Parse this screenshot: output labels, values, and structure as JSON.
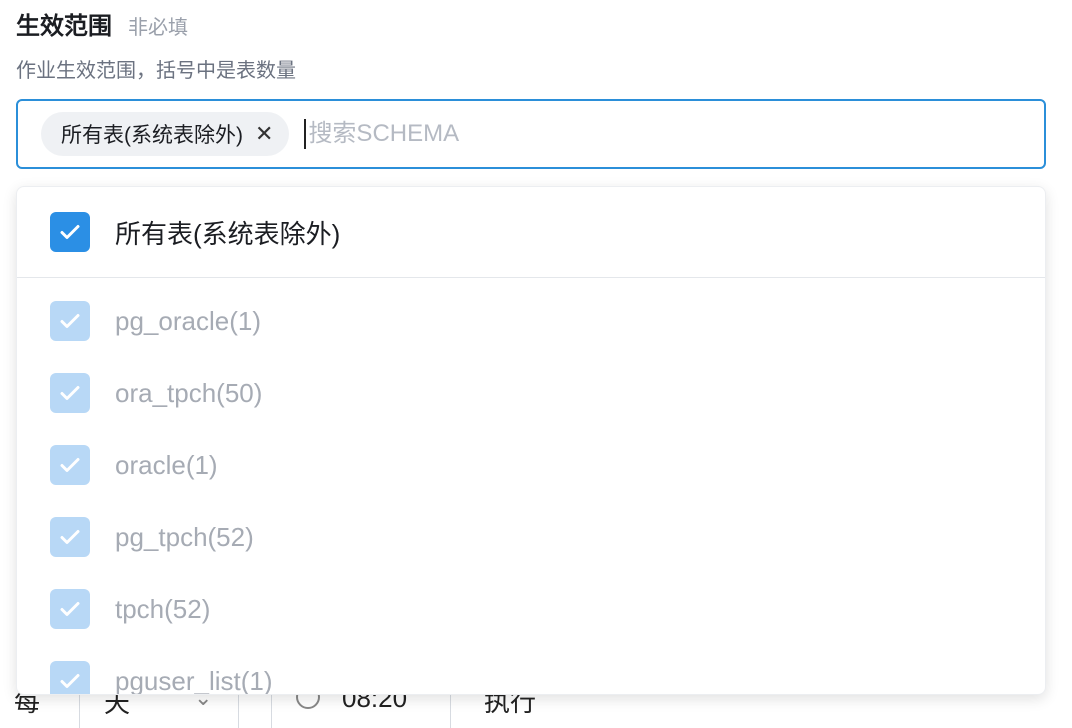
{
  "field": {
    "label": "生效范围",
    "optional": "非必填",
    "description": "作业生效范围，括号中是表数量"
  },
  "select": {
    "selected_tags": [
      {
        "label": "所有表(系统表除外)",
        "close_glyph": "✕"
      }
    ],
    "search_placeholder": "搜索SCHEMA",
    "search_value": ""
  },
  "dropdown": {
    "all_option": {
      "label": "所有表(系统表除外)",
      "checked": true
    },
    "options": [
      {
        "label": "pg_oracle(1)",
        "checked": true,
        "disabled": true
      },
      {
        "label": "ora_tpch(50)",
        "checked": true,
        "disabled": true
      },
      {
        "label": "oracle(1)",
        "checked": true,
        "disabled": true
      },
      {
        "label": "pg_tpch(52)",
        "checked": true,
        "disabled": true
      },
      {
        "label": "tpch(52)",
        "checked": true,
        "disabled": true
      },
      {
        "label": "pguser_list(1)",
        "checked": true,
        "disabled": true
      }
    ]
  },
  "schedule_row": {
    "prefix": "每",
    "unit_value": "天",
    "time_value": "08:20",
    "action": "执行"
  },
  "colors": {
    "accent": "#2b8fe5",
    "checkbox_disabled": "#b8d8f6",
    "muted_text": "#a6abb4"
  }
}
